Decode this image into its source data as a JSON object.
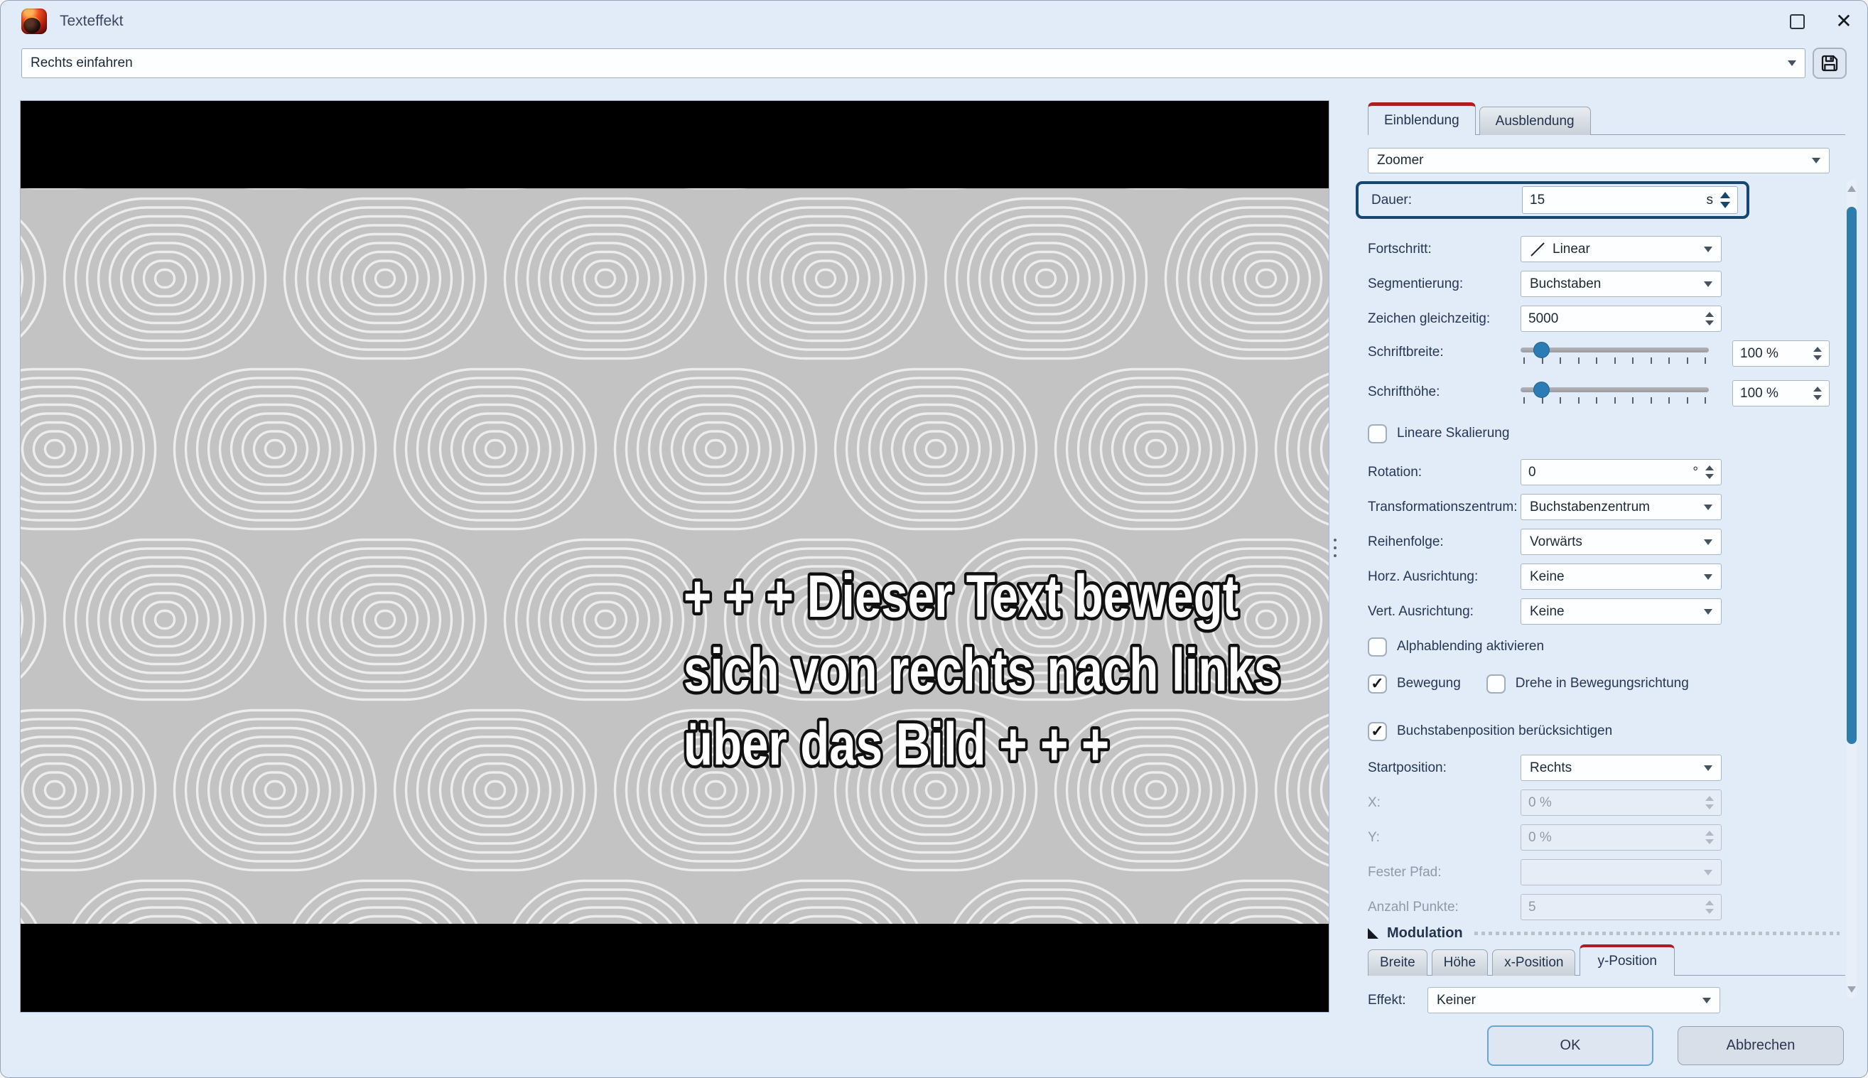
{
  "window": {
    "title": "Texteffekt"
  },
  "toolbar": {
    "preset": "Rechts einfahren",
    "save_icon": "floppy-disk"
  },
  "preview": {
    "line1": "+ + + Dieser Text bewegt",
    "line2": "sich von rechts nach links",
    "line3": "über das Bild + + +"
  },
  "panel": {
    "tab_einblendung": "Einblendung",
    "tab_ausblendung": "Ausblendung",
    "effect": "Zoomer",
    "dauer": {
      "label": "Dauer:",
      "value": "15",
      "unit": "s"
    },
    "fortschritt": {
      "label": "Fortschritt:",
      "value": "Linear",
      "icon": "linear-curve"
    },
    "segmentierung": {
      "label": "Segmentierung:",
      "value": "Buchstaben"
    },
    "zeichen": {
      "label": "Zeichen gleichzeitig:",
      "value": "5000"
    },
    "schriftbreite": {
      "label": "Schriftbreite:",
      "value": "100 %"
    },
    "schrifthoehe": {
      "label": "Schrifthöhe:",
      "value": "100 %"
    },
    "lineare_skalierung": {
      "label": "Lineare Skalierung",
      "checked": false
    },
    "rotation": {
      "label": "Rotation:",
      "value": "0",
      "unit": "°"
    },
    "transformationszentrum": {
      "label": "Transformationszentrum:",
      "value": "Buchstabenzentrum"
    },
    "reihenfolge": {
      "label": "Reihenfolge:",
      "value": "Vorwärts"
    },
    "horz_ausrichtung": {
      "label": "Horz. Ausrichtung:",
      "value": "Keine"
    },
    "vert_ausrichtung": {
      "label": "Vert. Ausrichtung:",
      "value": "Keine"
    },
    "alphablending": {
      "label": "Alphablending aktivieren",
      "checked": false
    },
    "bewegung": {
      "label": "Bewegung",
      "checked": true
    },
    "drehe": {
      "label": "Drehe in Bewegungsrichtung",
      "checked": false
    },
    "buchstabenposition": {
      "label": "Buchstabenposition berücksichtigen",
      "checked": true
    },
    "startposition": {
      "label": "Startposition:",
      "value": "Rechts"
    },
    "x": {
      "label": "X:",
      "value": "0 %",
      "disabled": true
    },
    "y": {
      "label": "Y:",
      "value": "0 %",
      "disabled": true
    },
    "fester_pfad": {
      "label": "Fester Pfad:",
      "value": "",
      "disabled": true
    },
    "anzahl_punkte": {
      "label": "Anzahl Punkte:",
      "value": "5",
      "disabled": true
    },
    "modulation": {
      "title": "Modulation",
      "tabs": [
        "Breite",
        "Höhe",
        "x-Position",
        "y-Position"
      ],
      "active_tab": "y-Position",
      "effekt": {
        "label": "Effekt:",
        "value": "Keiner"
      }
    }
  },
  "buttons": {
    "ok": "OK",
    "cancel": "Abbrechen"
  },
  "colors": {
    "accent_red": "#ab1f1f",
    "highlight_navy": "#17476e",
    "slider_blue": "#2b7cb5",
    "scrollbar_blue": "#2e7cad",
    "panel_bg": "#e2ebf8",
    "field_bg": "#fcfeff",
    "preview_pattern_bg": "#c3c3c3",
    "preview_pattern_line": "#ededed"
  }
}
